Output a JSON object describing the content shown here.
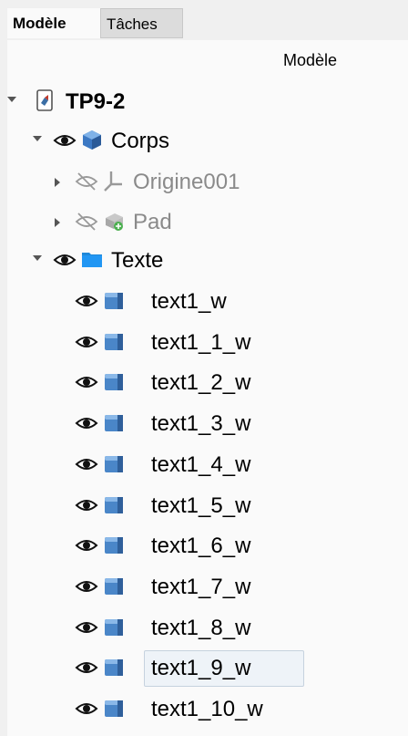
{
  "tabs": {
    "model": "Modèle",
    "tasks": "Tâches"
  },
  "tree_header": "Modèle",
  "document": {
    "name": "TP9-2"
  },
  "body": {
    "name": "Corps"
  },
  "children": [
    {
      "name": "Origine001",
      "icon": "origin-icon",
      "visible": false
    },
    {
      "name": "Pad",
      "icon": "pad-icon",
      "visible": false
    }
  ],
  "group": {
    "name": "Texte"
  },
  "items": [
    {
      "name": "text1_w"
    },
    {
      "name": "text1_1_w"
    },
    {
      "name": "text1_2_w"
    },
    {
      "name": "text1_3_w"
    },
    {
      "name": "text1_4_w"
    },
    {
      "name": "text1_5_w"
    },
    {
      "name": "text1_6_w"
    },
    {
      "name": "text1_7_w"
    },
    {
      "name": "text1_8_w"
    },
    {
      "name": "text1_9_w",
      "selected": true
    },
    {
      "name": "text1_10_w"
    }
  ],
  "colors": {
    "part_blue": "#4a86c8",
    "folder_blue": "#1e88d9",
    "greyed": "#8a8a8a"
  }
}
